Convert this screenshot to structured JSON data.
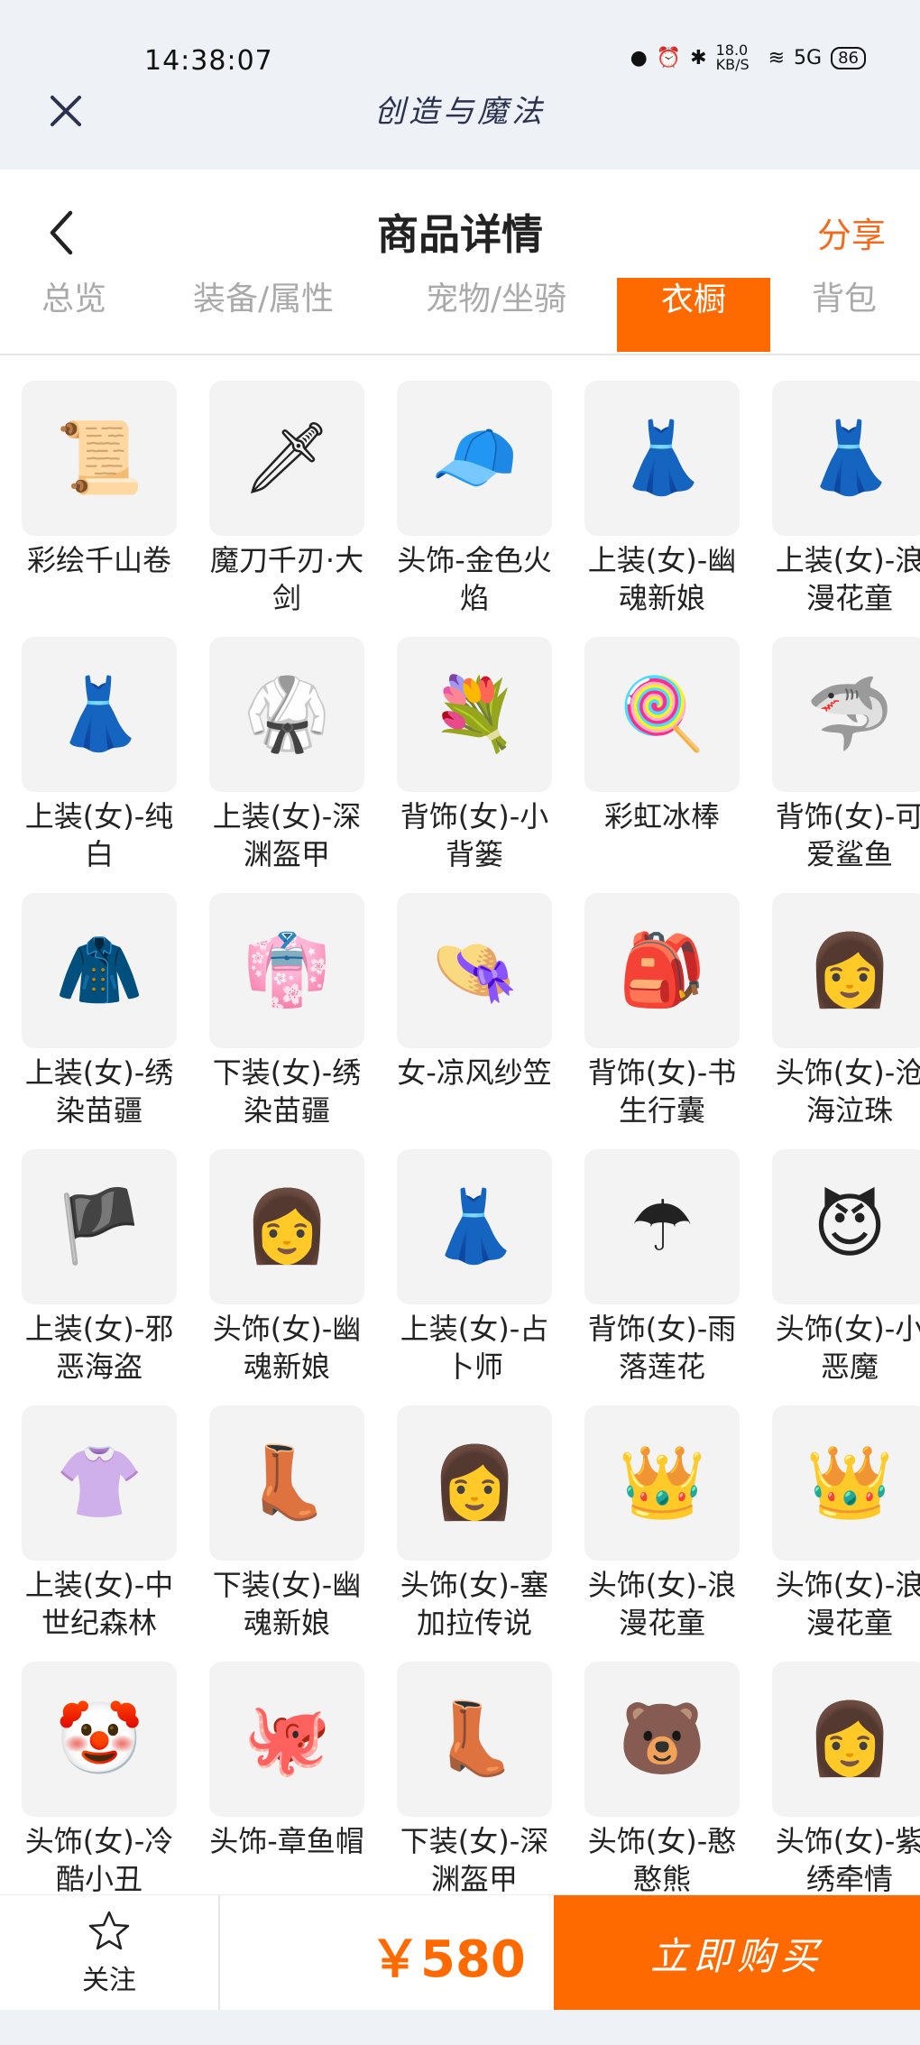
{
  "status": {
    "time": "14:38:07",
    "speed": "18.0 KB/S",
    "network": "5G",
    "battery": "86"
  },
  "app": {
    "logo_text": "创造与魔法"
  },
  "header": {
    "title": "商品详情",
    "share_label": "分享"
  },
  "tabs": [
    {
      "label": "总览"
    },
    {
      "label": "装备/属性"
    },
    {
      "label": "宠物/坐骑"
    },
    {
      "label": "衣橱",
      "active": true
    },
    {
      "label": "背包"
    }
  ],
  "items": [
    {
      "name": "彩绘千山卷",
      "icon": "scroll-icon"
    },
    {
      "name": "魔刀千刃·大剑",
      "icon": "sword-icon"
    },
    {
      "name": "头饰-金色火焰",
      "icon": "cap-icon"
    },
    {
      "name": "上装(女)-幽魂新娘",
      "icon": "dress-icon"
    },
    {
      "name": "上装(女)-浪漫花童",
      "icon": "dress-icon"
    },
    {
      "name": "上装(女)-纯白",
      "icon": "dress-icon"
    },
    {
      "name": "上装(女)-深渊盔甲",
      "icon": "armor-icon"
    },
    {
      "name": "背饰(女)-小背篓",
      "icon": "flower-basket-icon"
    },
    {
      "name": "彩虹冰棒",
      "icon": "popsicle-icon"
    },
    {
      "name": "背饰(女)-可爱鲨鱼",
      "icon": "shark-icon"
    },
    {
      "name": "上装(女)-绣染苗疆",
      "icon": "poncho-icon"
    },
    {
      "name": "下装(女)-绣染苗疆",
      "icon": "skirt-icon"
    },
    {
      "name": "女-凉风纱笠",
      "icon": "hat-veil-icon"
    },
    {
      "name": "背饰(女)-书生行囊",
      "icon": "backpack-icon"
    },
    {
      "name": "头饰(女)-沧海泣珠",
      "icon": "hair-icon"
    },
    {
      "name": "上装(女)-邪恶海盗",
      "icon": "pirate-icon"
    },
    {
      "name": "头饰(女)-幽魂新娘",
      "icon": "hair-icon"
    },
    {
      "name": "上装(女)-占卜师",
      "icon": "dress-icon"
    },
    {
      "name": "背饰(女)-雨落莲花",
      "icon": "umbrella-icon"
    },
    {
      "name": "头饰(女)-小恶魔",
      "icon": "horns-icon"
    },
    {
      "name": "上装(女)-中世纪森林",
      "icon": "blouse-icon"
    },
    {
      "name": "下装(女)-幽魂新娘",
      "icon": "boots-icon"
    },
    {
      "name": "头饰(女)-塞加拉传说",
      "icon": "hair-icon"
    },
    {
      "name": "头饰(女)-浪漫花童",
      "icon": "crown-icon"
    },
    {
      "name": "头饰(女)-浪漫花童",
      "icon": "crown-icon"
    },
    {
      "name": "头饰(女)-冷酷小丑",
      "icon": "clown-icon"
    },
    {
      "name": "头饰-章鱼帽",
      "icon": "octopus-icon"
    },
    {
      "name": "下装(女)-深渊盔甲",
      "icon": "boots-icon"
    },
    {
      "name": "头饰(女)-憨憨熊",
      "icon": "bear-icon"
    },
    {
      "name": "头饰(女)-紫绣牵情",
      "icon": "hair-icon"
    }
  ],
  "bottom": {
    "follow_label": "关注",
    "price": "￥580",
    "buy_label": "立即购买"
  },
  "colors": {
    "accent": "#ff6a00",
    "share": "#f26a1b"
  }
}
